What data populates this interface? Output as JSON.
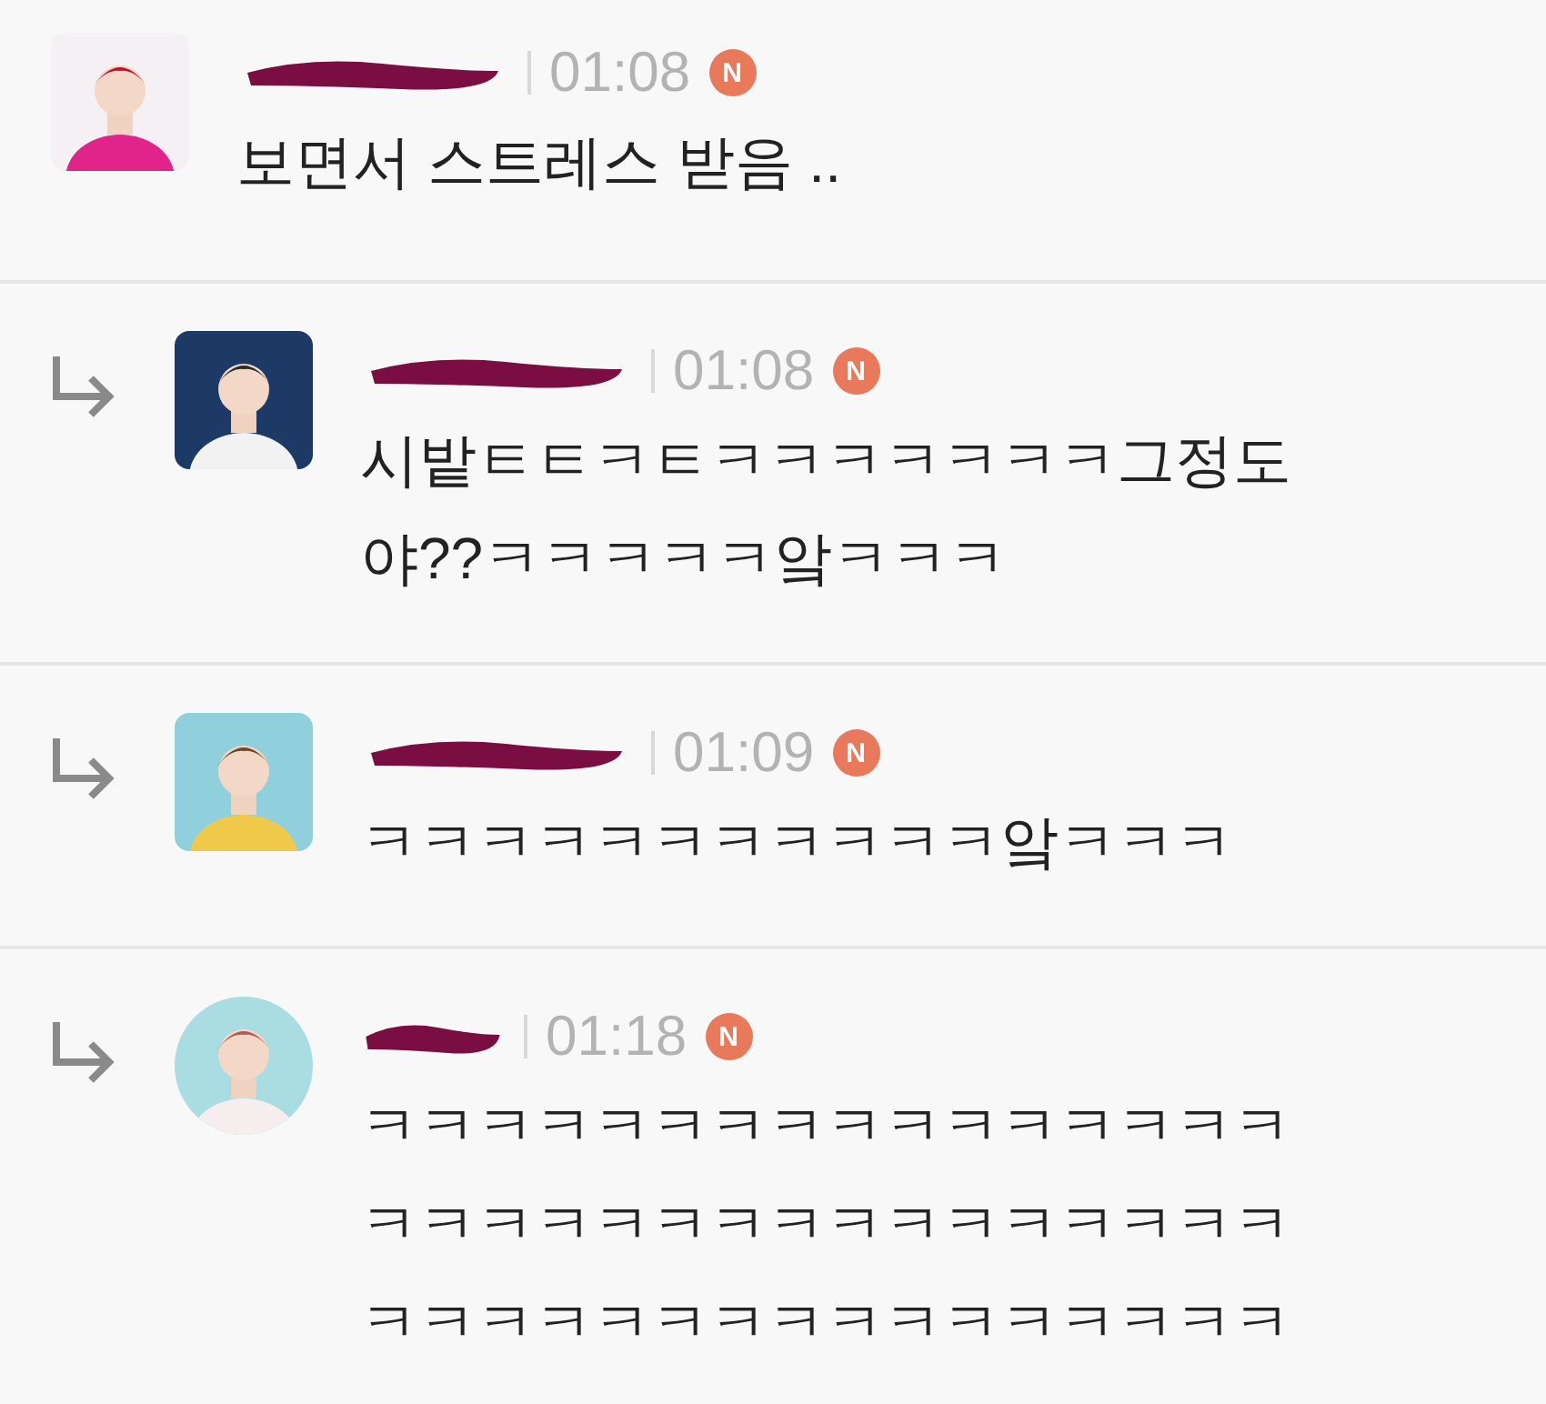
{
  "comments": [
    {
      "reply": false,
      "avatar": {
        "kind": "picture",
        "round": false
      },
      "name_redacted": true,
      "time": "01:08",
      "badge": "N",
      "lines": [
        "보면서 스트레스 받음 .."
      ]
    },
    {
      "reply": true,
      "avatar": {
        "kind": "picture",
        "round": false
      },
      "name_redacted": true,
      "time": "01:08",
      "badge": "N",
      "lines": [
        "시밭ㅌㅌㅋㅌㅋㅋㅋㅋㅋㅋㅋ그정도",
        "야??ㅋㅋㅋㅋㅋ앜ㅋㅋㅋ"
      ]
    },
    {
      "reply": true,
      "avatar": {
        "kind": "picture",
        "round": false
      },
      "name_redacted": true,
      "time": "01:09",
      "badge": "N",
      "lines": [
        "ㅋㅋㅋㅋㅋㅋㅋㅋㅋㅋㅋ앜ㅋㅋㅋ"
      ]
    },
    {
      "reply": true,
      "avatar": {
        "kind": "picture",
        "round": true
      },
      "name_redacted": true,
      "time": "01:18",
      "badge": "N",
      "lines": [
        "ㅋㅋㅋㅋㅋㅋㅋㅋㅋㅋㅋㅋㅋㅋㅋㅋ",
        "ㅋㅋㅋㅋㅋㅋㅋㅋㅋㅋㅋㅋㅋㅋㅋㅋ",
        "ㅋㅋㅋㅋㅋㅋㅋㅋㅋㅋㅋㅋㅋㅋㅋㅋ"
      ]
    }
  ]
}
